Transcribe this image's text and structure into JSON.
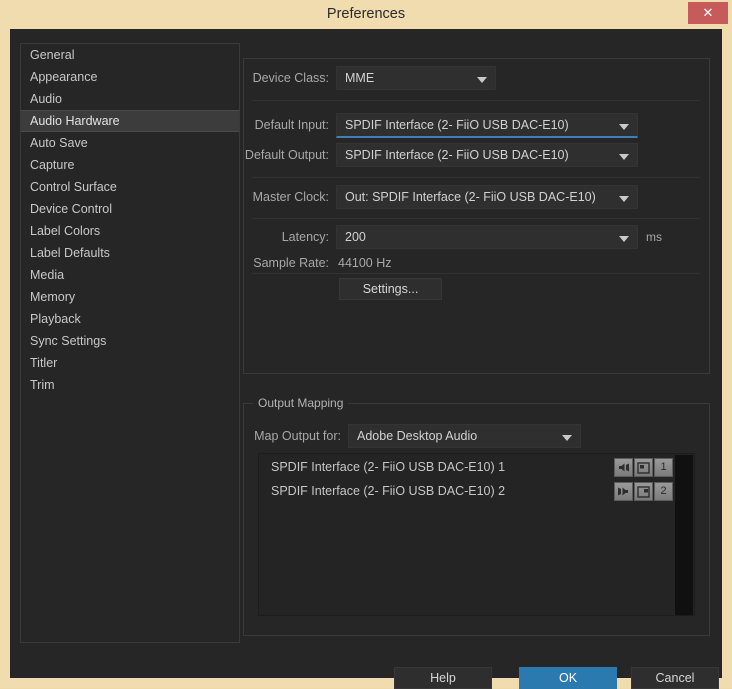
{
  "window": {
    "title": "Preferences",
    "close_label": "✕",
    "accent_color": "#2a7ab0",
    "frame_color": "#f0dcae",
    "close_button_color": "#c75b5b"
  },
  "sidebar": {
    "selected": "Audio Hardware",
    "items": [
      {
        "label": "General"
      },
      {
        "label": "Appearance"
      },
      {
        "label": "Audio"
      },
      {
        "label": "Audio Hardware"
      },
      {
        "label": "Auto Save"
      },
      {
        "label": "Capture"
      },
      {
        "label": "Control Surface"
      },
      {
        "label": "Device Control"
      },
      {
        "label": "Label Colors"
      },
      {
        "label": "Label Defaults"
      },
      {
        "label": "Media"
      },
      {
        "label": "Memory"
      },
      {
        "label": "Playback"
      },
      {
        "label": "Sync Settings"
      },
      {
        "label": "Titler"
      },
      {
        "label": "Trim"
      }
    ]
  },
  "device_panel": {
    "device_class": {
      "label": "Device Class:",
      "value": "MME"
    },
    "default_input": {
      "label": "Default Input:",
      "value": "SPDIF Interface (2- FiiO USB DAC-E10)"
    },
    "default_output": {
      "label": "Default Output:",
      "value": "SPDIF Interface (2- FiiO USB DAC-E10)"
    },
    "master_clock": {
      "label": "Master Clock:",
      "value": "Out: SPDIF Interface (2- FiiO USB DAC-E10)"
    },
    "latency": {
      "label": "Latency:",
      "value": "200",
      "suffix": "ms"
    },
    "sample_rate": {
      "label": "Sample Rate:",
      "value": "44100 Hz"
    },
    "settings_button": "Settings..."
  },
  "output_mapping": {
    "group_label": "Output Mapping",
    "map_output_for": {
      "label": "Map Output for:",
      "value": "Adobe Desktop Audio"
    },
    "channels": [
      {
        "name": "SPDIF Interface (2- FiiO USB DAC-E10) 1",
        "number": "1"
      },
      {
        "name": "SPDIF Interface (2- FiiO USB DAC-E10) 2",
        "number": "2"
      }
    ]
  },
  "footer": {
    "help": "Help",
    "ok": "OK",
    "cancel": "Cancel"
  }
}
